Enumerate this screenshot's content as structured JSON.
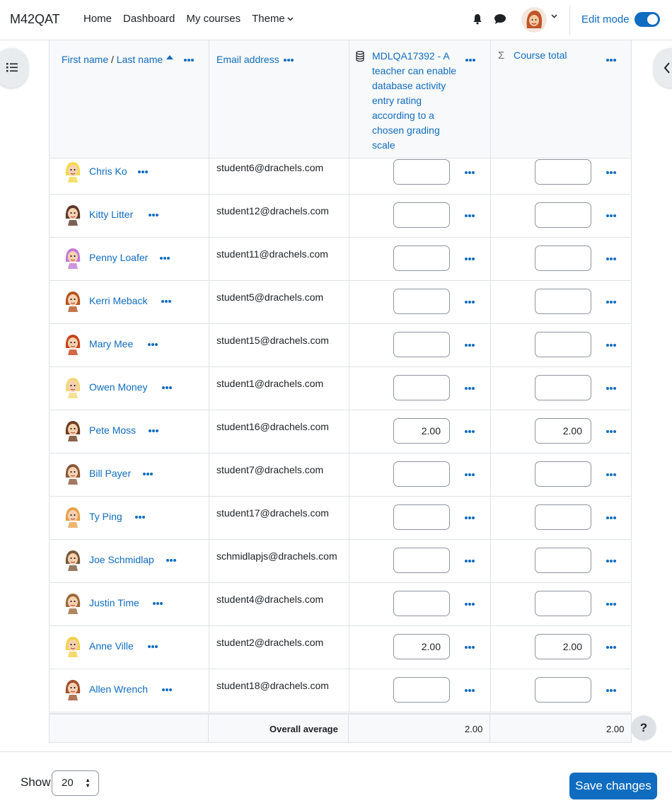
{
  "navbar": {
    "brand": "M42QAT",
    "links": [
      "Home",
      "Dashboard",
      "My courses"
    ],
    "theme_label": "Theme",
    "edit_mode_label": "Edit mode",
    "edit_mode_on": true
  },
  "table": {
    "headers": {
      "first_name": "First name",
      "separator": " / ",
      "last_name": "Last name",
      "email": "Email address",
      "activity": "MDLQA17392 - A teacher can enable database activity entry rating according to a chosen grading scale",
      "course_total": "Course total"
    },
    "rows": [
      {
        "name": "Chris Ko",
        "email": "student6@drachels.com",
        "activity_grade": "",
        "total_grade": "",
        "avatar_color": "#f5d94a"
      },
      {
        "name": "Kitty Litter",
        "email": "student12@drachels.com",
        "activity_grade": "",
        "total_grade": "",
        "avatar_color": "#5a3a2a"
      },
      {
        "name": "Penny Loafer",
        "email": "student11@drachels.com",
        "activity_grade": "",
        "total_grade": "",
        "avatar_color": "#c27ad8"
      },
      {
        "name": "Kerri Meback",
        "email": "student5@drachels.com",
        "activity_grade": "",
        "total_grade": "",
        "avatar_color": "#b5541e"
      },
      {
        "name": "Mary Mee",
        "email": "student15@drachels.com",
        "activity_grade": "",
        "total_grade": "",
        "avatar_color": "#c8441e"
      },
      {
        "name": "Owen Money",
        "email": "student1@drachels.com",
        "activity_grade": "",
        "total_grade": "",
        "avatar_color": "#f0d97a"
      },
      {
        "name": "Pete Moss",
        "email": "student16@drachels.com",
        "activity_grade": "2.00",
        "total_grade": "2.00",
        "avatar_color": "#6b3f1f"
      },
      {
        "name": "Bill Payer",
        "email": "student7@drachels.com",
        "activity_grade": "",
        "total_grade": "",
        "avatar_color": "#8a5a3a"
      },
      {
        "name": "Ty Ping",
        "email": "student17@drachels.com",
        "activity_grade": "",
        "total_grade": "",
        "avatar_color": "#e8a24a"
      },
      {
        "name": "Joe Schmidlap",
        "email": "schmidlapjs@drachels.com",
        "activity_grade": "",
        "total_grade": "",
        "avatar_color": "#7a5a3a"
      },
      {
        "name": "Justin Time",
        "email": "student4@drachels.com",
        "activity_grade": "",
        "total_grade": "",
        "avatar_color": "#9a6a3a"
      },
      {
        "name": "Anne Ville",
        "email": "student2@drachels.com",
        "activity_grade": "2.00",
        "total_grade": "2.00",
        "avatar_color": "#f2d24a"
      },
      {
        "name": "Allen Wrench",
        "email": "student18@drachels.com",
        "activity_grade": "",
        "total_grade": "",
        "avatar_color": "#a0522d"
      }
    ],
    "overall_average_label": "Overall average",
    "overall_activity": "2.00",
    "overall_total": "2.00"
  },
  "help_label": "?",
  "footer": {
    "show_label": "Show",
    "per_page": "20",
    "save_label": "Save changes"
  },
  "colors": {
    "primary": "#0f6cbf",
    "border": "#dee2e6",
    "header_bg": "#f8f9fa"
  }
}
